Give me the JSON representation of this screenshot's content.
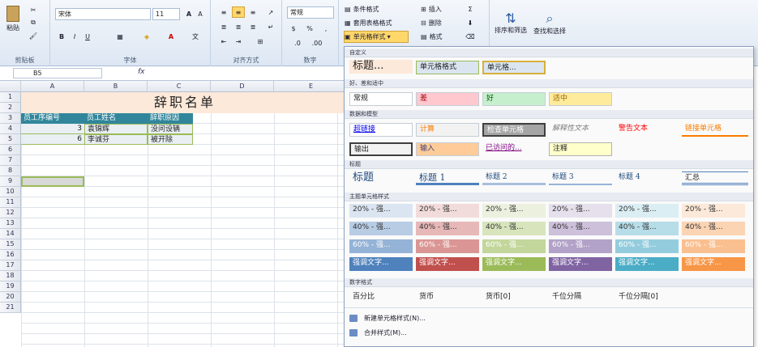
{
  "ribbon": {
    "clipboard": {
      "label": "剪贴板",
      "paste": "粘贴"
    },
    "font": {
      "label": "字体",
      "family": "宋体",
      "size": "11"
    },
    "align": {
      "label": "对齐方式"
    },
    "number": {
      "label": "数字",
      "format": "常规"
    },
    "styles": {
      "conditional": "条件格式",
      "table_format": "套用表格格式",
      "cell_styles": "单元格样式"
    },
    "cells": {
      "insert": "插入",
      "delete": "删除",
      "format": "格式"
    },
    "editing": {
      "sort": "排序和筛选",
      "find": "查找和选择"
    }
  },
  "formula_bar": {
    "name_box": "B5",
    "fx": "fx"
  },
  "columns": [
    "A",
    "B",
    "C",
    "D",
    "E"
  ],
  "rows": [
    "1",
    "2",
    "3",
    "4",
    "5",
    "6",
    "7",
    "8",
    "9",
    "10",
    "11",
    "12",
    "13",
    "14",
    "15",
    "16",
    "17",
    "18",
    "19",
    "20",
    "21"
  ],
  "sheet": {
    "title": "辞职名单",
    "headers": [
      "员工序编号",
      "员工姓名",
      "辞职原因"
    ],
    "rows": [
      [
        "3",
        "袁锦辉",
        "没问设辆"
      ],
      [
        "6",
        "李诚芬",
        "被开除"
      ]
    ]
  },
  "gallery": {
    "custom": {
      "label": "自定义",
      "items": [
        "标题...",
        "单元格格式",
        "单元格..."
      ]
    },
    "goodbad": {
      "label": "好、差和适中",
      "items": [
        "常规",
        "差",
        "好",
        "适中"
      ]
    },
    "datamodel": {
      "label": "数据和模型",
      "items": [
        "超链接",
        "计算",
        "检查单元格",
        "解释性文本",
        "警告文本",
        "链接单元格",
        "输出",
        "输入",
        "已访问的...",
        "注释"
      ]
    },
    "titles": {
      "label": "标题",
      "items": [
        "标题",
        "标题 1",
        "标题 2",
        "标题 3",
        "标题 4",
        "汇总"
      ]
    },
    "theme": {
      "label": "主题单元格样式",
      "row20": [
        "20% - 强...",
        "20% - 强...",
        "20% - 强...",
        "20% - 强...",
        "20% - 强...",
        "20% - 强..."
      ],
      "row40": [
        "40% - 强...",
        "40% - 强...",
        "40% - 强...",
        "40% - 强...",
        "40% - 强...",
        "40% - 强..."
      ],
      "row60": [
        "60% - 强...",
        "60% - 强...",
        "60% - 强...",
        "60% - 强...",
        "60% - 强...",
        "60% - 强..."
      ],
      "accent": [
        "强调文字...",
        "强调文字...",
        "强调文字...",
        "强调文字...",
        "强调文字...",
        "强调文字..."
      ]
    },
    "numfmt": {
      "label": "数字格式",
      "items": [
        "百分比",
        "货币",
        "货币[0]",
        "千位分隔",
        "千位分隔[0]"
      ]
    },
    "commands": [
      "新建单元格样式(N)...",
      "合并样式(M)..."
    ]
  },
  "colors": {
    "theme": [
      "#dbe5f1",
      "#f2dcdb",
      "#ebf1de",
      "#e5e0ec",
      "#dbeef4",
      "#fde9d9"
    ],
    "theme40": [
      "#b8cce4",
      "#e6b8b7",
      "#d7e4bc",
      "#ccc0da",
      "#b7dde8",
      "#fbd4b4"
    ],
    "theme60": [
      "#95b3d7",
      "#da9694",
      "#c3d69b",
      "#b2a2c7",
      "#93cddd",
      "#fabf8f"
    ],
    "accent": [
      "#4f81bd",
      "#c0504d",
      "#9bbb59",
      "#8064a2",
      "#4bacc6",
      "#f79646"
    ]
  }
}
